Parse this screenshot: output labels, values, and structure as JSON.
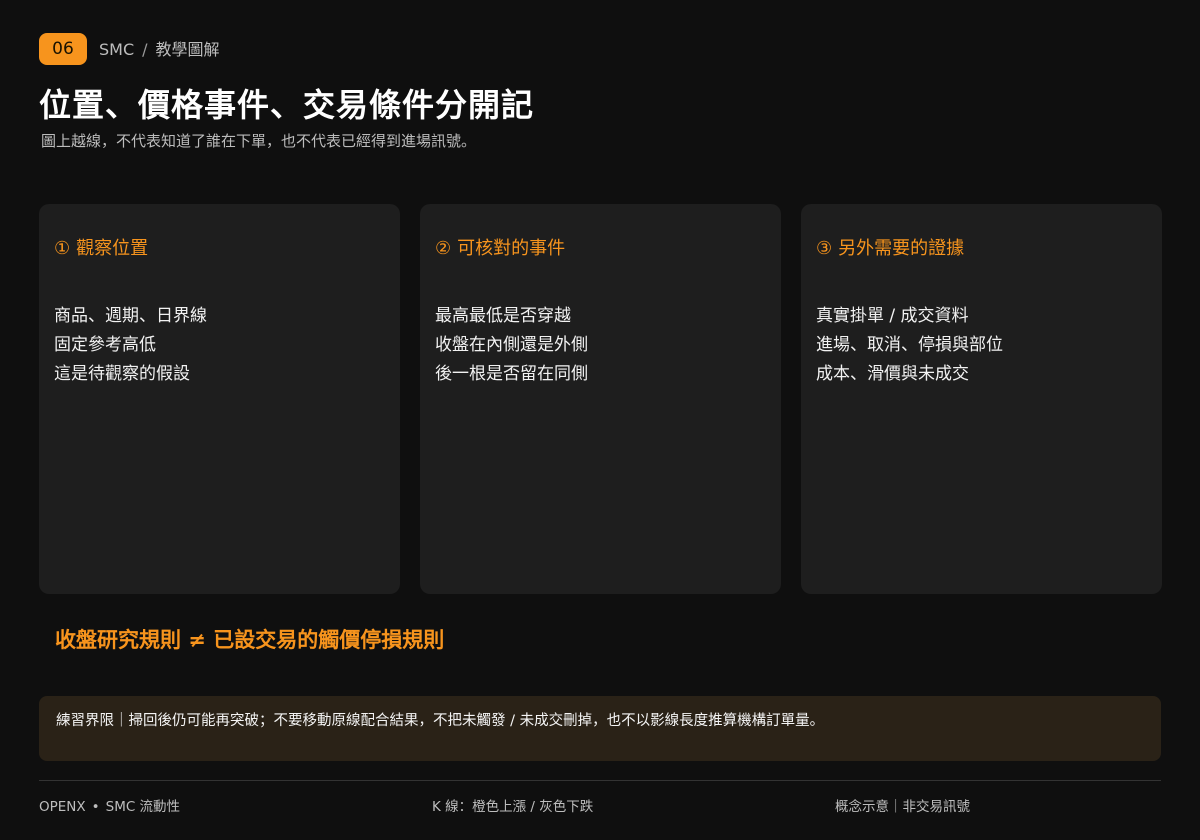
{
  "header": {
    "badge": "06",
    "breadcrumb_section": "SMC",
    "breadcrumb_separator": "/",
    "breadcrumb_page": "教學圖解",
    "title": "位置、價格事件、交易條件分開記",
    "subtitle": "圖上越線，不代表知道了誰在下單，也不代表已經得到進場訊號。"
  },
  "cards": [
    {
      "number": "①",
      "heading": "觀察位置",
      "lines": [
        "商品、週期、日界線",
        "固定參考高低",
        "這是待觀察的假設"
      ]
    },
    {
      "number": "②",
      "heading": "可核對的事件",
      "lines": [
        "最高最低是否穿越",
        "收盤在內側還是外側",
        "後一根是否留在同側"
      ]
    },
    {
      "number": "③",
      "heading": "另外需要的證據",
      "lines": [
        "真實掛單 / 成交資料",
        "進場、取消、停損與部位",
        "成本、滑價與未成交"
      ]
    }
  ],
  "rule": {
    "text": "收盤研究規則 ≠ 已設交易的觸價停損規則"
  },
  "note": {
    "text": "練習界限｜掃回後仍可能再突破；不要移動原線配合結果，不把未觸發 / 未成交刪掉，也不以影線長度推算機構訂單量。"
  },
  "footer": {
    "brand": "OPENX",
    "dot": "•",
    "brand_topic": "SMC 流動性",
    "legend": "K 線：橙色上漲 / 灰色下跌",
    "disclaimer": "概念示意｜非交易訊號"
  },
  "colors": {
    "background": "#0f0f0f",
    "card": "#1e1e1e",
    "accent": "#f7941d",
    "note_background": "#2a2217"
  }
}
